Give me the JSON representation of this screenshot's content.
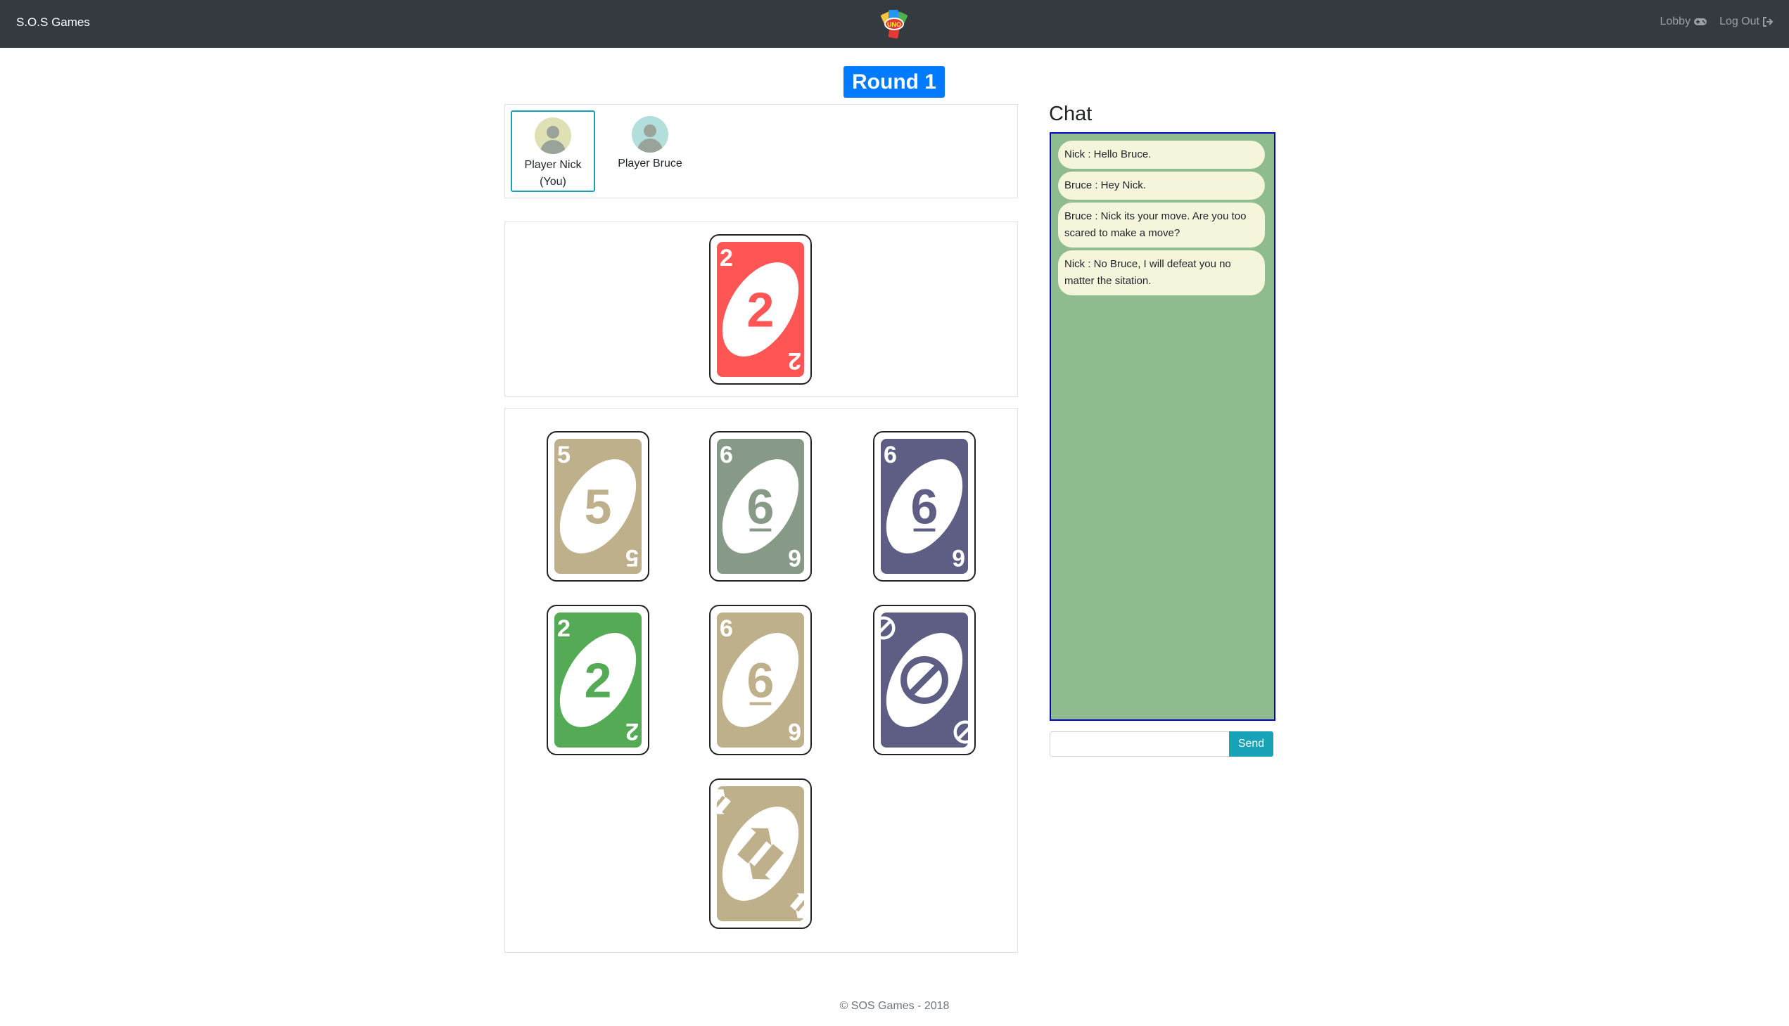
{
  "nav": {
    "brand": "S.O.S Games",
    "lobby_label": "Lobby",
    "logout_label": "Log Out"
  },
  "round": {
    "label": "Round 1"
  },
  "players": [
    {
      "name": "Player Nick",
      "tag": "(You)",
      "avatar_color": "#e0e0b5"
    },
    {
      "name": "Player Bruce",
      "avatar_color": "#b2dfdb"
    }
  ],
  "discard": {
    "value": "2",
    "color": "#ff5555"
  },
  "hand": [
    {
      "value": "5",
      "color": "#bfb08c"
    },
    {
      "value": "6",
      "color": "#879a87"
    },
    {
      "value": "6",
      "color": "#5e5e85"
    },
    {
      "value": "2",
      "color": "#55aa55"
    },
    {
      "value": "6",
      "color": "#bfb08c"
    },
    {
      "value": "skip",
      "color": "#5e5e85"
    },
    {
      "value": "reverse",
      "color": "#bfb08c"
    }
  ],
  "chat": {
    "title": "Chat",
    "messages": [
      {
        "text": "Nick : Hello Bruce."
      },
      {
        "text": "Bruce : Hey Nick."
      },
      {
        "text": "Bruce : Nick its your move. Are you too scared to make a move?"
      },
      {
        "text": "Nick : No Bruce, I will defeat you no matter the sitation."
      }
    ],
    "input_value": "",
    "send_label": "Send"
  },
  "footer": {
    "text": "© SOS Games - 2018"
  },
  "colors": {
    "navbar": "#343a40",
    "round_badge": "#007bff",
    "chat_bg": "#8fbc8f",
    "chat_border": "#0000cd",
    "bubble": "#f5f5dc",
    "send_button": "#17a2b8"
  }
}
